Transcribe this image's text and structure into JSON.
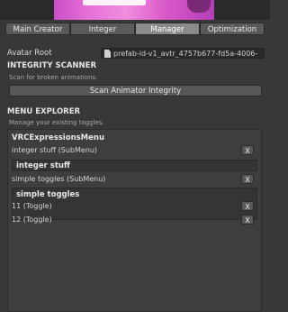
{
  "tabs": [
    {
      "label": "Main Creator"
    },
    {
      "label": "Integer"
    },
    {
      "label": "Manager"
    },
    {
      "label": "Optimization"
    }
  ],
  "active_tab": "Manager",
  "avatar_root": {
    "label": "Avatar Root",
    "value": "prefab-id-v1_avtr_4757b677-fd5a-4006-"
  },
  "integrity": {
    "title": "INTEGRITY SCANNER",
    "hint": "Scan for broken animations.",
    "button": "Scan Animator Integrity"
  },
  "menu_explorer": {
    "title": "MENU EXPLORER",
    "hint": "Manage your existing toggles.",
    "menus": [
      {
        "title": "VRCExpressionsMenu",
        "items": [
          "integer stuff (SubMenu)"
        ]
      },
      {
        "title": "integer stuff",
        "items": [
          "simple toggles (SubMenu)"
        ]
      },
      {
        "title": "simple toggles",
        "items": [
          "11 (Toggle)",
          "12 (Toggle)"
        ]
      }
    ],
    "remove_label": "X"
  },
  "colors": {
    "background": "#383838",
    "active_tab": "#8a8a8a",
    "banner_accent": "#d958c8"
  }
}
